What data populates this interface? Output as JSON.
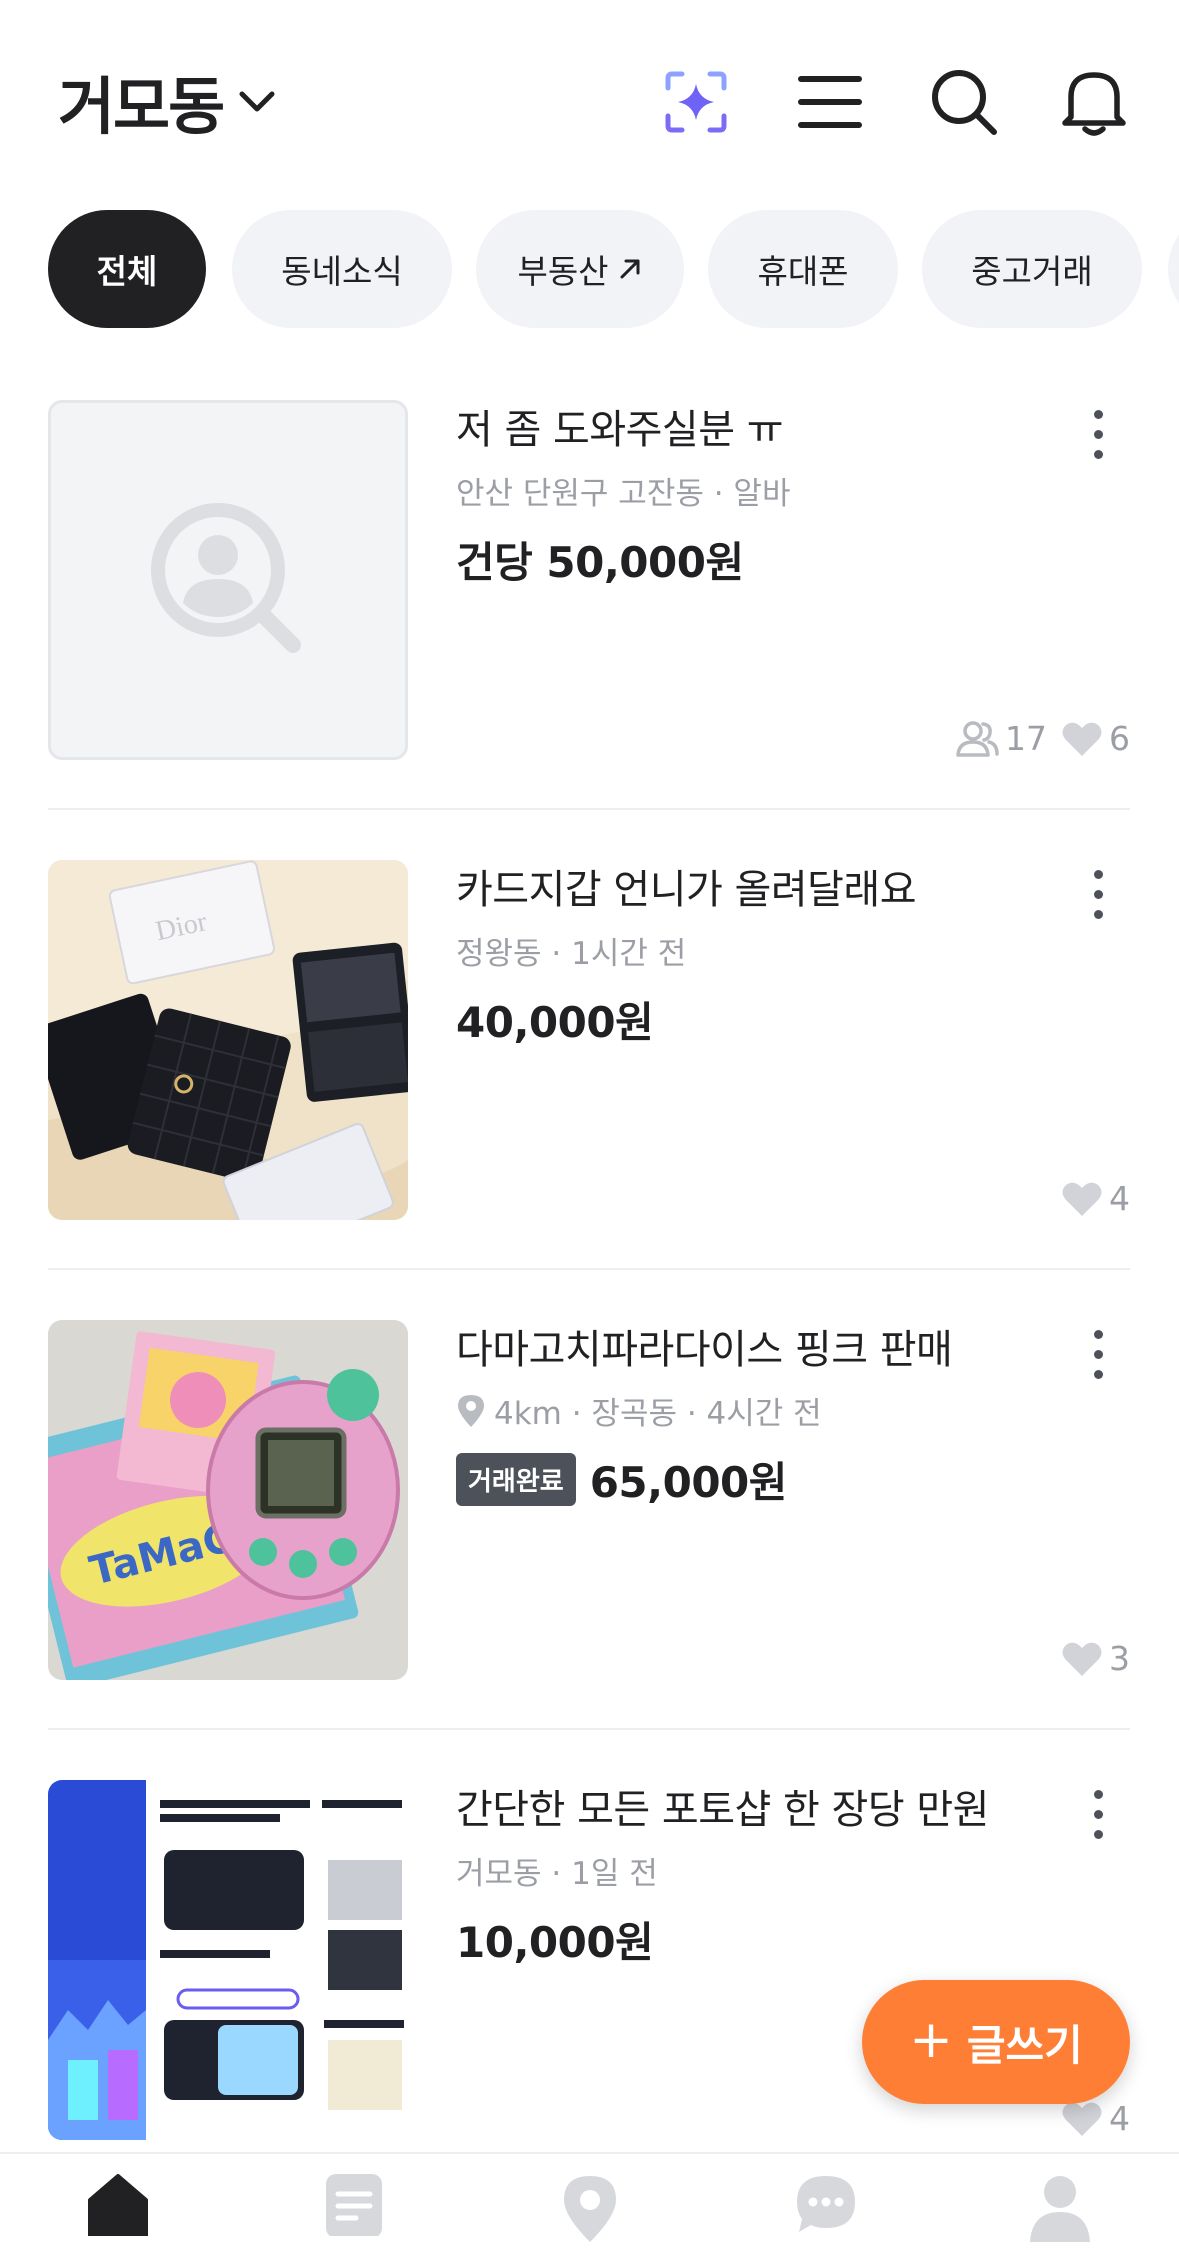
{
  "header": {
    "location": "거모동",
    "icons": [
      "chevron-down-icon",
      "ai-sparkle-icon",
      "menu-icon",
      "search-icon",
      "bell-icon"
    ]
  },
  "chips": [
    {
      "label": "전체",
      "active": true
    },
    {
      "label": "동네소식",
      "active": false
    },
    {
      "label": "부동산",
      "active": false,
      "external": true
    },
    {
      "label": "휴대폰",
      "active": false
    },
    {
      "label": "중고거래",
      "active": false
    }
  ],
  "items": [
    {
      "title": "저 좀 도와주실분 ㅠ",
      "meta": "안산 단원구 고잔동 · 알바",
      "price": "건당 50,000원",
      "chats": "17",
      "likes": "6"
    },
    {
      "title": "카드지갑 언니가 올려달래요",
      "meta": "정왕동 · 1시간 전",
      "price": "40,000원",
      "likes": "4"
    },
    {
      "title": "다마고치파라다이스 핑크 판매",
      "meta": "4km · 장곡동 · 4시간 전",
      "badge": "거래완료",
      "price": "65,000원",
      "likes": "3"
    },
    {
      "title": "간단한 모든 포토샵 한 장당 만원",
      "meta": "거모동 · 1일 전",
      "price": "10,000원",
      "likes": "4"
    }
  ],
  "fab": {
    "plus": "+",
    "label": "글쓰기"
  },
  "colors": {
    "accent": "#ff7e36",
    "text": "#212124",
    "muted": "#9b9ea4",
    "chip_bg": "#f2f3f6"
  },
  "bottom_nav": [
    "home-icon",
    "document-icon",
    "location-pin-icon",
    "chat-icon",
    "profile-icon"
  ]
}
